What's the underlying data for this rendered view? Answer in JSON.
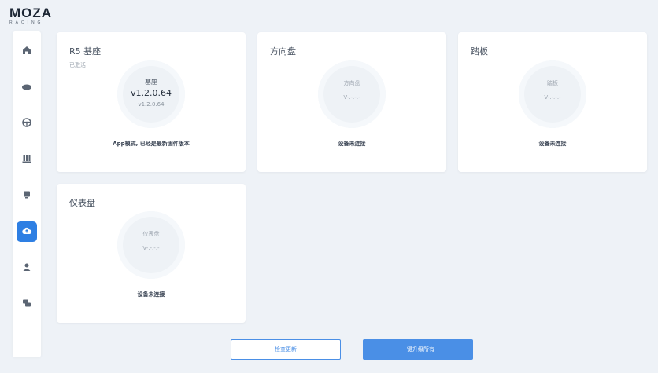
{
  "app": {
    "logo_text": "MOZA",
    "logo_sub": "RACING"
  },
  "sidebar": {
    "items": [
      {
        "icon": "home-icon",
        "active": false
      },
      {
        "icon": "wheelbase-icon",
        "active": false
      },
      {
        "icon": "steering-wheel-icon",
        "active": false
      },
      {
        "icon": "pedals-icon",
        "active": false
      },
      {
        "icon": "dashboard-icon",
        "active": false
      },
      {
        "icon": "cloud-upload-icon",
        "active": true
      },
      {
        "icon": "user-icon",
        "active": false
      },
      {
        "icon": "chat-icon",
        "active": false
      }
    ]
  },
  "cards": {
    "base": {
      "title": "R5 基座",
      "subtitle": "已激活",
      "ring_label": "基座",
      "version": "v1.2.0.64",
      "version_small": "v1.2.0.64",
      "status": "App模式, 已经是最新固件版本"
    },
    "wheel": {
      "title": "方向盘",
      "ring_label": "方向盘",
      "version": "V-.-.-.-",
      "status": "设备未连接"
    },
    "pedal": {
      "title": "踏板",
      "ring_label": "踏板",
      "version": "V-.-.-.-",
      "status": "设备未连接"
    },
    "dash": {
      "title": "仪表盘",
      "ring_label": "仪表盘",
      "version": "V-.-.-.-",
      "status": "设备未连接"
    }
  },
  "buttons": {
    "check_update": "检查更新",
    "upgrade_all": "一键升级所有"
  },
  "colors": {
    "accent": "#2e7fe3",
    "button_blue": "#4a8fe6",
    "background": "#eef2f7"
  }
}
